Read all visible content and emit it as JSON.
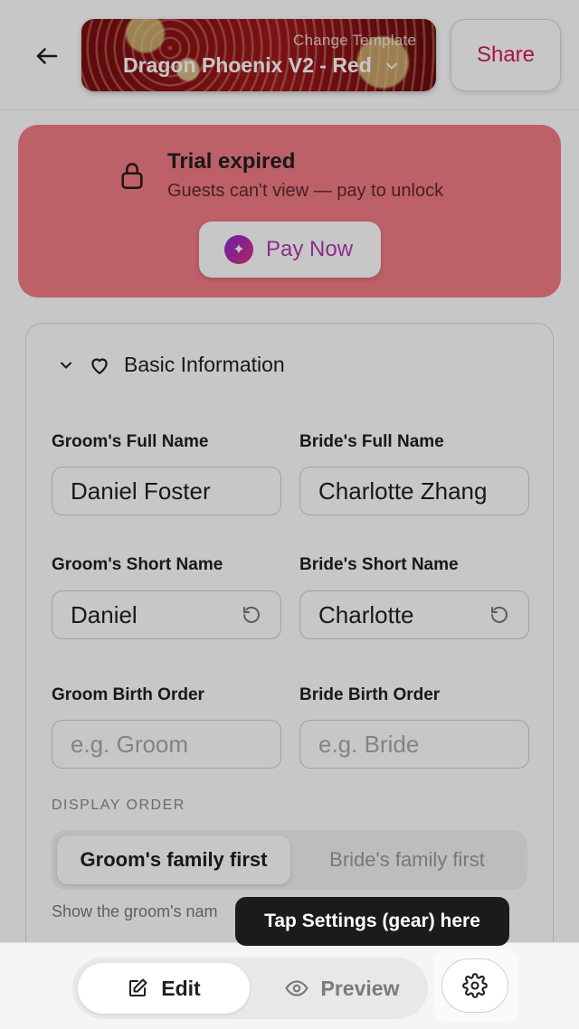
{
  "header": {
    "template_caption": "Change Template",
    "template_name": "Dragon Phoenix V2 - Red",
    "share_label": "Share"
  },
  "trial": {
    "title": "Trial expired",
    "subtitle": "Guests can't view — pay to unlock",
    "pay_label": "Pay Now"
  },
  "basic": {
    "section_title": "Basic Information",
    "groom_full_label": "Groom's Full Name",
    "groom_full_value": "Daniel Foster",
    "bride_full_label": "Bride's Full Name",
    "bride_full_value": "Charlotte Zhang",
    "groom_short_label": "Groom's Short Name",
    "groom_short_value": "Daniel",
    "bride_short_label": "Bride's Short Name",
    "bride_short_value": "Charlotte",
    "groom_order_label": "Groom Birth Order",
    "groom_order_placeholder": "e.g. Groom",
    "bride_order_label": "Bride Birth Order",
    "bride_order_placeholder": "e.g. Bride",
    "display_order_label": "DISPLAY ORDER",
    "option_groom_first": "Groom's family first",
    "option_bride_first": "Bride's family first",
    "hint": "Show the groom's nam"
  },
  "bottom": {
    "edit_label": "Edit",
    "preview_label": "Preview"
  },
  "tooltip": "Tap Settings (gear) here"
}
